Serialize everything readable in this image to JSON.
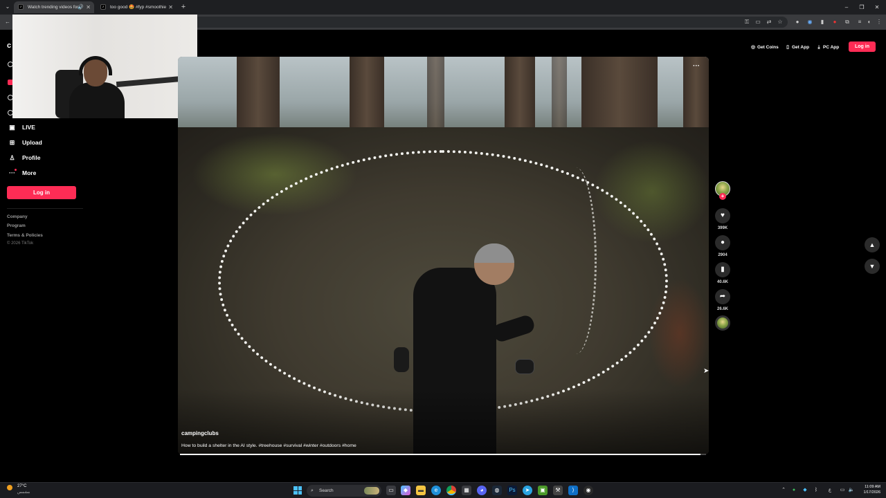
{
  "browser": {
    "tabs": [
      {
        "title": "Watch trending videos for y",
        "active": true
      },
      {
        "title": "too good 🤩 #fyp #smoothie",
        "active": false
      }
    ],
    "new_tab": "+",
    "window_controls": [
      "–",
      "❐",
      "✕"
    ]
  },
  "sidebar": {
    "logo": "c",
    "items": [
      {
        "label": "LIVE",
        "icon": "live-icon"
      },
      {
        "label": "Upload",
        "icon": "upload-icon"
      },
      {
        "label": "Profile",
        "icon": "profile-icon"
      },
      {
        "label": "More",
        "icon": "more-icon"
      }
    ],
    "login_label": "Log in",
    "footer_links": [
      "Company",
      "Program",
      "Terms & Policies"
    ],
    "copyright": "© 2026 TikTok"
  },
  "header": {
    "get_coins": "Get Coins",
    "get_app": "Get App",
    "pc_app": "PC App",
    "login_label": "Log in"
  },
  "video": {
    "more_label": "···",
    "author": "campingclubs",
    "caption": "How to build a shelter in the AI style. #treehouse #survival #winter #outdoors #home",
    "progress": 0.99
  },
  "actions": {
    "likes": "399K",
    "comments": "2904",
    "saves": "40.6K",
    "shares": "26.6K"
  },
  "taskbar": {
    "temp": "27°C",
    "weather_sub": "مشمس",
    "search_placeholder": "Search",
    "time": "11:09 AM",
    "date": "1/17/2026"
  },
  "colors": {
    "brand": "#fe2c55",
    "background": "#000000"
  }
}
